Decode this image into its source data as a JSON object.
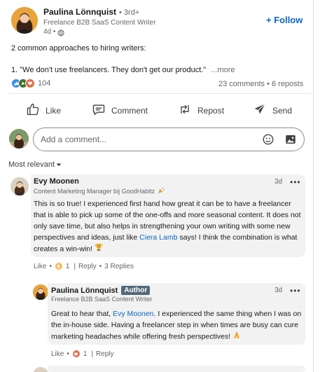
{
  "post": {
    "author": {
      "name": "Paulina Lönnquist",
      "degree": "• 3rd+",
      "headline": "Freelance B2B SaaS Content Writer",
      "time": "4d •"
    },
    "follow_label": "+ Follow",
    "line1": "2 common approaches to hiring writers:",
    "line2": "1. \"We don't use freelancers. They don't get our product.\"",
    "more": "...more",
    "reaction_count": "104",
    "comments_reposts": "23 comments • 6 reposts"
  },
  "actions": {
    "like": "Like",
    "comment": "Comment",
    "repost": "Repost",
    "send": "Send"
  },
  "composer": {
    "placeholder": "Add a comment..."
  },
  "sort": {
    "label": "Most relevant"
  },
  "comment1": {
    "name": "Evy Moonen",
    "headline": "Content Marketing Manager bij GoodHabitz",
    "time": "3d",
    "text_a": "This is so true! I experienced first hand how great it can be to have a freelancer that is able to pick up some of the one-offs and more seasonal content. It does not only save time, but also helps in strengthening your own writing with some new perspectives and ideas, just like ",
    "mention": "Ciera Lamb",
    "text_b": " says! I think the combination is what creates a win-win!",
    "like": "Like",
    "reaction_count": "1",
    "reply": "Reply",
    "replies": "3 Replies"
  },
  "reply1": {
    "name": "Paulina Lönnquist",
    "badge": "Author",
    "headline": "Freelance B2B SaaS Content Writer",
    "time": "3d",
    "text_a": "Great to hear that, ",
    "mention": "Evy Moonen",
    "text_b": ". I experienced the same thing when I was on the in-house side. Having a freelancer step in when times are busy can cure marketing headaches while offering fresh perspectives!",
    "like": "Like",
    "reaction_count": "1",
    "reply": "Reply"
  },
  "colors": {
    "accent": "#0a66c2",
    "avatar_bg": "#e8a33a",
    "bubble": "#f2f2f2"
  }
}
